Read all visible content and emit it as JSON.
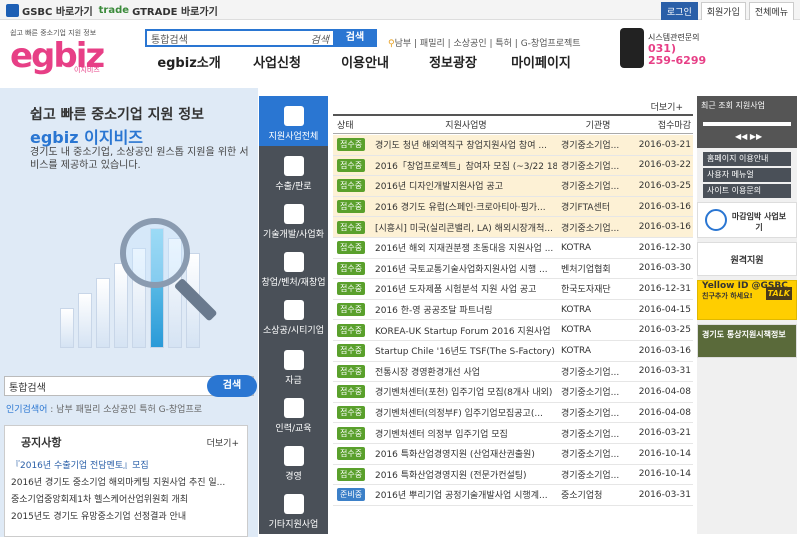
{
  "topbar": {
    "gsbc": "GSBC 바로가기",
    "trade": "trade",
    "gtrade": "GTRADE 바로가기",
    "login": "로그인",
    "join": "회원가입",
    "allmenu": "전체메뉴"
  },
  "header": {
    "logo_sub": "쉽고 빠른 중소기업 지원 정보",
    "logo": "egbiz",
    "logo_kr": "이지비즈",
    "search_placeholder": "통합검색",
    "search_label": "검색",
    "search_btn": "검색",
    "keywords": "남부 | 패밀리 | 소상공인 | 특허 | G-창업프로젝트",
    "gnb": [
      "egbiz소개",
      "사업신청",
      "이용안내",
      "정보광장",
      "마이페이지"
    ],
    "call_label": "시스템관련문의",
    "call_num": "031)\n259-6299"
  },
  "hero": {
    "title": "쉽고 빠른 중소기업 지원 정보",
    "brand": "egbiz 이지비즈",
    "desc": "경기도 내 중소기업, 소상공인 원스톱 지원을 위한 서비스를 제공하고 있습니다.",
    "search_placeholder": "통합검색",
    "search_label": "검색",
    "search_btn": "검색",
    "kw_label": "인기검색어",
    "kw": " : 남부 패밀리 소상공인 특허 G-창업프로"
  },
  "notice": {
    "title": "공지사항",
    "more": "더보기+",
    "items": [
      "『2016년 수출기업 전담멘토』모집",
      "2016년 경기도 중소기업 해외마케팅 지원사업 추진 일...",
      "중소기업중앙회제1차 헬스케어산업위원회 개최",
      "2015년도 경기도 유망중소기업 선정결과 안내"
    ]
  },
  "nav": [
    "지원사업전체",
    "수출/판로",
    "기술개발/사업화",
    "창업/벤처/재창업",
    "소상공/시티기업",
    "자금",
    "인력/교육",
    "경영",
    "기타지원사업"
  ],
  "list": {
    "more": "더보기+",
    "headers": [
      "상태",
      "지원사업명",
      "기관명",
      "접수마감"
    ],
    "rows": [
      [
        "접수중",
        "경기도 청년 해외역직구 창업지원사업 참여 ...",
        "경기중소기업...",
        "2016-03-21",
        1
      ],
      [
        "접수중",
        "2016「창업프로젝트」참여자 모집 (~3/22 18...",
        "경기중소기업...",
        "2016-03-22",
        1
      ],
      [
        "접수중",
        "2016년 디자인개발지원사업 공고",
        "경기중소기업...",
        "2016-03-25",
        1
      ],
      [
        "접수중",
        "2016 경기도 유럽(스페인·크로아티아·핑가...",
        "경기FTA센터",
        "2016-03-16",
        1
      ],
      [
        "접수중",
        "[시흥시] 미국(실리콘밸리, LA) 해외시장개척...",
        "경기중소기업...",
        "2016-03-16",
        1
      ],
      [
        "접수중",
        "2016년 해외 지재권분쟁 초동대응 지원사업 ...",
        "KOTRA",
        "2016-12-30",
        0
      ],
      [
        "접수중",
        "2016년 국토교통기술사업화지원사업 시행 ...",
        "벤처기업협회",
        "2016-03-30",
        0
      ],
      [
        "접수중",
        "2016년 도자제품 시험분석 지원 사업 공고",
        "한국도자재단",
        "2016-12-31",
        0
      ],
      [
        "접수중",
        "2016 한-영 공공조달 파트너링",
        "KOTRA",
        "2016-04-15",
        0
      ],
      [
        "접수중",
        "KOREA-UK Startup Forum 2016 지원사업",
        "KOTRA",
        "2016-03-25",
        0
      ],
      [
        "접수중",
        "Startup Chile '16년도 TSF(The S-Factory) 1...",
        "KOTRA",
        "2016-03-16",
        0
      ],
      [
        "접수중",
        "전통시장 경영환경개선 사업",
        "경기중소기업...",
        "2016-03-31",
        0
      ],
      [
        "접수중",
        "경기벤처센터(포천) 입주기업 모집(8개사 내외)",
        "경기중소기업...",
        "2016-04-08",
        0
      ],
      [
        "접수중",
        "경기벤처센터(의정부F) 입주기업모집공고(...",
        "경기중소기업...",
        "2016-04-08",
        0
      ],
      [
        "접수중",
        "경기벤처센터 의정부 입주기업 모집",
        "경기중소기업...",
        "2016-03-21",
        0
      ],
      [
        "접수중",
        "2016 특화산업경영지원 (산업재산권출원)",
        "경기중소기업...",
        "2016-10-14",
        0
      ],
      [
        "접수중",
        "2016 특화산업경영지원 (전문가컨설팅)",
        "경기중소기업...",
        "2016-10-14",
        0
      ],
      [
        "준비중",
        "2016년 뿌리기업 공정기술개발사업 시행계...",
        "중소기업청",
        "2016-03-31",
        0
      ]
    ]
  },
  "right": {
    "recent": "최근 조회 지원사업",
    "arrows": "◀◀ ▶▶",
    "home": "홈페이지 이용안내",
    "manual": "사용자 메뉴얼",
    "site": "사이트 이용문의",
    "deadline": "마감임박 사업보기",
    "remote": "원격지원",
    "yellow": "Yellow ID @GSBC",
    "yellow_sub": "친구추가 하세요!",
    "talk": "TALK",
    "gg": "경기도 통상지원시책정보"
  }
}
